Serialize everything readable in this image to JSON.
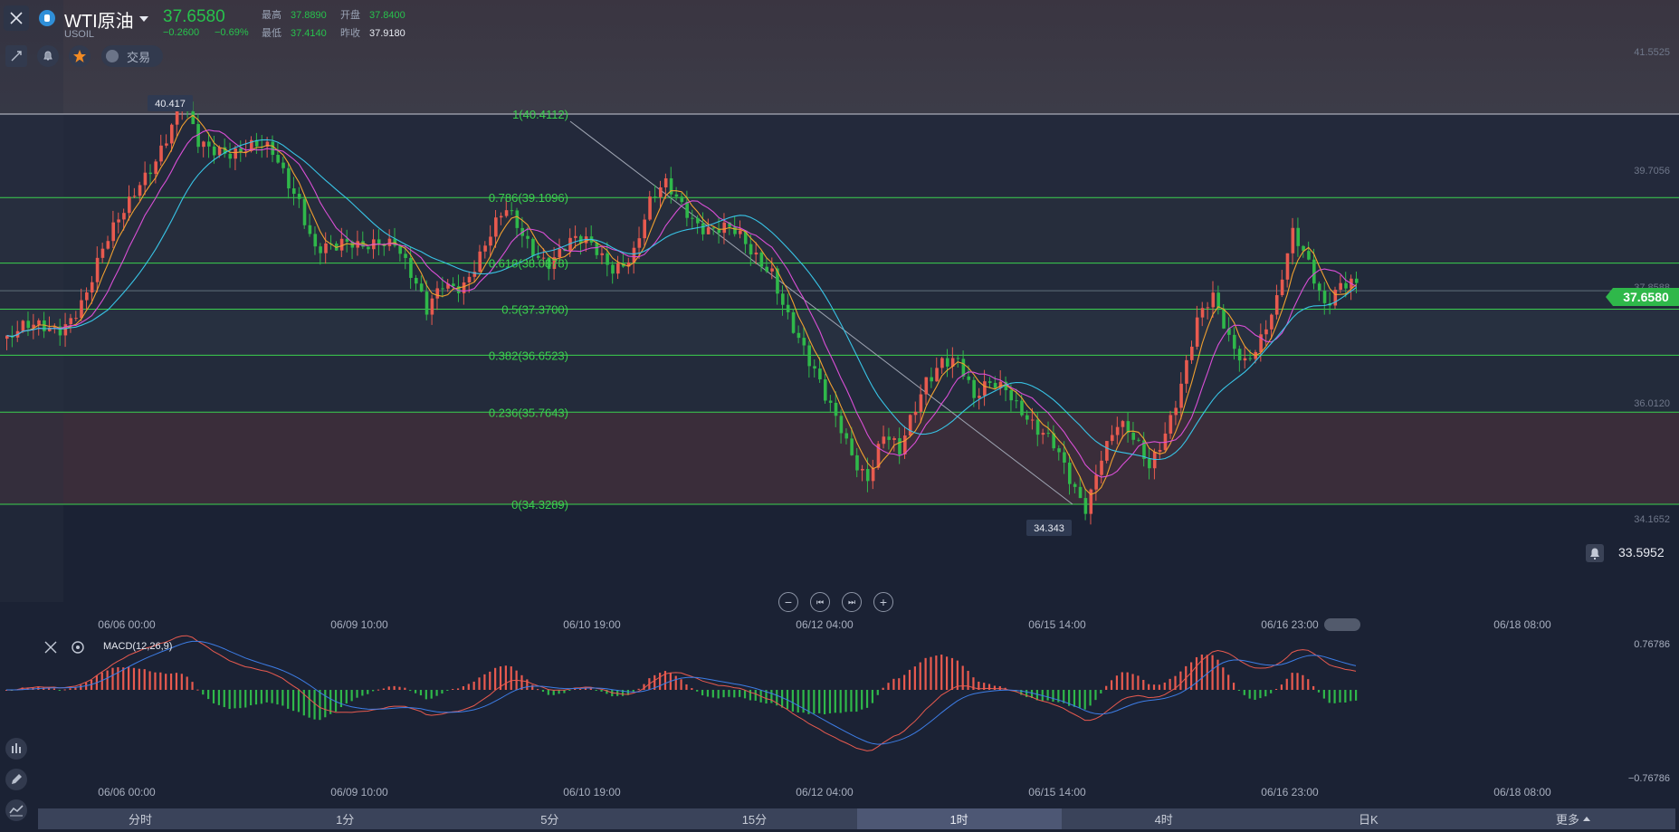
{
  "header": {
    "symbol_name": "WTI原油",
    "symbol_code": "USOIL",
    "last_price": "37.6580",
    "change": "−0.2600",
    "change_pct": "−0.69%",
    "stats": {
      "high_label": "最高",
      "high": "37.8890",
      "open_label": "开盘",
      "open": "37.8400",
      "low_label": "最低",
      "low": "37.4140",
      "prev_close_label": "昨收",
      "prev_close": "37.9180"
    }
  },
  "toolbar": {
    "trade_label": "交易",
    "icons": [
      "draw-tool-icon",
      "bell-icon",
      "star-icon",
      "list-icon"
    ]
  },
  "main_chart": {
    "price_badge": "37.6580",
    "alert_value": "33.5952",
    "high_marker": "40.417",
    "low_marker": "34.343",
    "right_axis": [
      "41.5525",
      "39.7056",
      "37.8588",
      "36.0120",
      "34.1652"
    ],
    "fib_levels": [
      {
        "label": "1(40.4112)",
        "value": 40.4112
      },
      {
        "label": "0.786(39.1096)",
        "value": 39.1096
      },
      {
        "label": "0.618(38.0878)",
        "value": 38.0878
      },
      {
        "label": "0.5(37.3700)",
        "value": 37.37
      },
      {
        "label": "0.382(36.6523)",
        "value": 36.6523
      },
      {
        "label": "0.236(35.7643)",
        "value": 35.7643
      },
      {
        "label": "0(34.3289)",
        "value": 34.3289
      }
    ]
  },
  "x_axis_labels": [
    "06/06 00:00",
    "06/09 10:00",
    "06/10 19:00",
    "06/12 04:00",
    "06/15 14:00",
    "06/16 23:00",
    "06/18 08:00"
  ],
  "macd": {
    "title": "MACD(12,26,9)",
    "axis_top": "0.76786",
    "axis_bottom": "−0.76786"
  },
  "tabs": [
    "分时",
    "1分",
    "5分",
    "15分",
    "1时",
    "4时",
    "日K",
    "更多"
  ],
  "active_tab": "1时",
  "chart_data": {
    "type": "candlestick",
    "symbol": "USOIL",
    "interval": "1时",
    "x_labels": [
      "06/06 00:00",
      "06/09 10:00",
      "06/10 19:00",
      "06/12 04:00",
      "06/15 14:00",
      "06/16 23:00",
      "06/18 08:00"
    ],
    "close_path": [
      [
        0,
        36.88
      ],
      [
        5,
        36.98
      ],
      [
        10,
        37.2
      ],
      [
        15,
        37.6
      ],
      [
        20,
        38.5
      ],
      [
        25,
        39.5
      ],
      [
        30,
        40.0
      ],
      [
        33,
        40.42
      ],
      [
        36,
        39.9
      ],
      [
        40,
        40.0
      ],
      [
        45,
        39.85
      ],
      [
        50,
        39.7
      ],
      [
        55,
        39.2
      ],
      [
        58,
        38.4
      ],
      [
        62,
        38.2
      ],
      [
        66,
        38.3
      ],
      [
        70,
        38.6
      ],
      [
        73,
        38.5
      ],
      [
        76,
        37.8
      ],
      [
        79,
        37.2
      ],
      [
        82,
        37.8
      ],
      [
        86,
        37.9
      ],
      [
        90,
        38.3
      ],
      [
        94,
        38.8
      ],
      [
        98,
        38.5
      ],
      [
        102,
        38.2
      ],
      [
        106,
        38.3
      ],
      [
        110,
        38.3
      ],
      [
        114,
        38.15
      ],
      [
        118,
        38.3
      ],
      [
        121,
        38.9
      ],
      [
        124,
        39.2
      ],
      [
        128,
        39.0
      ],
      [
        132,
        38.7
      ],
      [
        136,
        38.5
      ],
      [
        140,
        38.2
      ],
      [
        144,
        38.1
      ],
      [
        148,
        37.1
      ],
      [
        151,
        36.4
      ],
      [
        154,
        35.9
      ],
      [
        157,
        35.6
      ],
      [
        160,
        35.1
      ],
      [
        162,
        34.8
      ],
      [
        165,
        35.3
      ],
      [
        168,
        35.0
      ],
      [
        170,
        35.6
      ],
      [
        173,
        36.4
      ],
      [
        176,
        36.7
      ],
      [
        179,
        36.5
      ],
      [
        182,
        35.8
      ],
      [
        185,
        36.2
      ],
      [
        188,
        36.3
      ],
      [
        191,
        35.9
      ],
      [
        194,
        35.4
      ],
      [
        197,
        35.1
      ],
      [
        200,
        34.7
      ],
      [
        203,
        34.42
      ],
      [
        206,
        35.2
      ],
      [
        209,
        35.5
      ],
      [
        212,
        35.2
      ],
      [
        215,
        34.9
      ],
      [
        218,
        35.6
      ],
      [
        221,
        36.3
      ],
      [
        224,
        37.1
      ],
      [
        227,
        37.4
      ],
      [
        230,
        36.9
      ],
      [
        233,
        36.7
      ],
      [
        236,
        37.0
      ],
      [
        239,
        37.4
      ],
      [
        242,
        38.4
      ],
      [
        245,
        38.1
      ],
      [
        248,
        37.6
      ],
      [
        251,
        37.85
      ],
      [
        254,
        37.66
      ]
    ],
    "ma_lines": [
      {
        "name": "MA5",
        "color": "#f0a030"
      },
      {
        "name": "MA10",
        "color": "#d94fd6"
      },
      {
        "name": "MA20",
        "color": "#38c4e6"
      }
    ],
    "macd_hist_colors": {
      "up": "#e85a4f",
      "down": "#2fb84a"
    },
    "macd_line_colors": {
      "dif": "#e85a4f",
      "dea": "#3d7de6"
    },
    "ylim": [
      34.1652,
      41.5525
    ]
  }
}
